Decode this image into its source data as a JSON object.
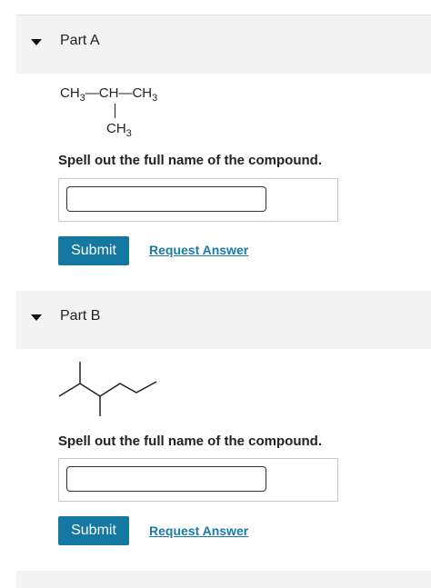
{
  "parts": [
    {
      "title": "Part A",
      "formula": {
        "main_left": "CH",
        "main_left_sub": "3",
        "dash1": "—",
        "center": "CH",
        "dash2": "—",
        "main_right": "CH",
        "main_right_sub": "3",
        "branch": "CH",
        "branch_sub": "3"
      },
      "prompt": "Spell out the full name of the compound.",
      "input_value": "",
      "submit_label": "Submit",
      "request_label": "Request Answer"
    },
    {
      "title": "Part B",
      "prompt": "Spell out the full name of the compound.",
      "input_value": "",
      "submit_label": "Submit",
      "request_label": "Request Answer"
    }
  ],
  "colors": {
    "header_bg": "#f3f3f3",
    "button_bg": "#1478a0",
    "link": "#1a7aa7"
  },
  "icons": {
    "collapse": "caret-down-icon"
  }
}
